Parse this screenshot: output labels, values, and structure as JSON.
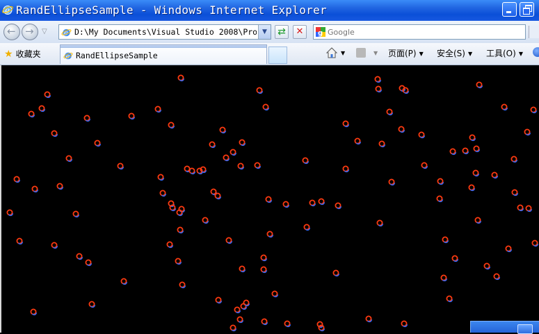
{
  "window": {
    "title": "RandEllipseSample - Windows Internet Explorer"
  },
  "address_bar": {
    "url": "D:\\My Documents\\Visual Studio 2008\\Pro"
  },
  "search": {
    "placeholder": "Google"
  },
  "favorites": {
    "label": "收藏夹"
  },
  "tabs": [
    {
      "label": "RandEllipseSample"
    }
  ],
  "commands": {
    "page": "页面(P)",
    "safety": "安全(S)",
    "tools": "工具(O)"
  },
  "icons": {
    "ie": "ie-logo-icon",
    "back": "back-arrow-icon",
    "forward": "forward-arrow-icon",
    "refresh": "refresh-icon",
    "stop": "stop-icon",
    "search_provider": "google-icon",
    "favorites": "star-icon",
    "home": "home-icon",
    "feeds": "rss-feed-icon",
    "help": "help-icon"
  },
  "colors": {
    "titlebar": "#0a4fd8",
    "content_background": "#000000",
    "ring_red": "#ff3a10",
    "ring_blue": "#2f6bff"
  },
  "canvas": {
    "ellipses": [
      [
        68,
        136
      ],
      [
        45,
        164
      ],
      [
        60,
        156
      ],
      [
        78,
        192
      ],
      [
        125,
        170
      ],
      [
        140,
        206
      ],
      [
        99,
        228
      ],
      [
        24,
        258
      ],
      [
        50,
        272
      ],
      [
        86,
        268
      ],
      [
        14,
        306
      ],
      [
        109,
        308
      ],
      [
        28,
        347
      ],
      [
        78,
        353
      ],
      [
        114,
        369
      ],
      [
        127,
        378
      ],
      [
        48,
        449
      ],
      [
        132,
        438
      ],
      [
        178,
        405
      ],
      [
        173,
        239
      ],
      [
        189,
        167
      ],
      [
        227,
        157
      ],
      [
        246,
        180
      ],
      [
        231,
        255
      ],
      [
        234,
        278
      ],
      [
        246,
        293
      ],
      [
        248,
        299
      ],
      [
        261,
        301
      ],
      [
        258,
        306
      ],
      [
        259,
        331
      ],
      [
        244,
        352
      ],
      [
        256,
        376
      ],
      [
        262,
        410
      ],
      [
        260,
        112
      ],
      [
        269,
        243
      ],
      [
        276,
        246
      ],
      [
        287,
        246
      ],
      [
        292,
        244
      ],
      [
        305,
        208
      ],
      [
        320,
        187
      ],
      [
        335,
        219
      ],
      [
        325,
        227
      ],
      [
        348,
        205
      ],
      [
        346,
        239
      ],
      [
        370,
        238
      ],
      [
        307,
        276
      ],
      [
        313,
        282
      ],
      [
        295,
        317
      ],
      [
        329,
        346
      ],
      [
        348,
        387
      ],
      [
        373,
        130
      ],
      [
        382,
        154
      ],
      [
        386,
        287
      ],
      [
        388,
        337
      ],
      [
        411,
        294
      ],
      [
        379,
        371
      ],
      [
        379,
        388
      ],
      [
        395,
        423
      ],
      [
        314,
        432
      ],
      [
        350,
        441
      ],
      [
        354,
        436
      ],
      [
        341,
        446
      ],
      [
        345,
        460
      ],
      [
        335,
        472
      ],
      [
        380,
        463
      ],
      [
        413,
        466
      ],
      [
        439,
        231
      ],
      [
        449,
        292
      ],
      [
        462,
        290
      ],
      [
        486,
        296
      ],
      [
        441,
        327
      ],
      [
        483,
        393
      ],
      [
        497,
        178
      ],
      [
        497,
        243
      ],
      [
        514,
        203
      ],
      [
        530,
        459
      ],
      [
        460,
        467
      ],
      [
        462,
        472
      ],
      [
        543,
        114
      ],
      [
        544,
        128
      ],
      [
        578,
        127
      ],
      [
        583,
        130
      ],
      [
        560,
        161
      ],
      [
        577,
        186
      ],
      [
        549,
        207
      ],
      [
        563,
        262
      ],
      [
        606,
        194
      ],
      [
        610,
        238
      ],
      [
        546,
        321
      ],
      [
        581,
        466
      ],
      [
        633,
        261
      ],
      [
        632,
        286
      ],
      [
        651,
        218
      ],
      [
        669,
        217
      ],
      [
        685,
        214
      ],
      [
        679,
        198
      ],
      [
        689,
        122
      ],
      [
        725,
        154
      ],
      [
        739,
        229
      ],
      [
        711,
        252
      ],
      [
        684,
        249
      ],
      [
        678,
        270
      ],
      [
        687,
        317
      ],
      [
        654,
        372
      ],
      [
        700,
        383
      ],
      [
        714,
        398
      ],
      [
        638,
        400
      ],
      [
        646,
        430
      ],
      [
        640,
        345
      ],
      [
        740,
        277
      ],
      [
        748,
        299
      ],
      [
        760,
        300
      ],
      [
        731,
        358
      ],
      [
        758,
        190
      ],
      [
        767,
        158
      ],
      [
        769,
        350
      ]
    ]
  }
}
